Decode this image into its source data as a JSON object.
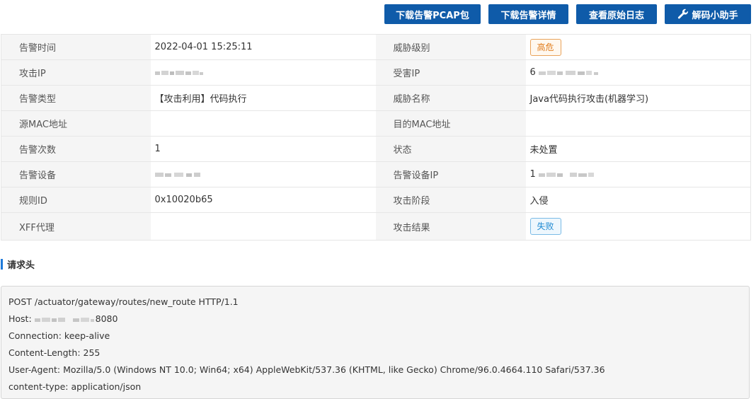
{
  "toolbar": {
    "download_pcap": "下载告警PCAP包",
    "download_detail": "下载告警详情",
    "view_raw_log": "查看原始日志",
    "decode_helper": "解码小助手"
  },
  "info": {
    "alert_time_label": "告警时间",
    "alert_time_value": "2022-04-01 15:25:11",
    "threat_level_label": "威胁级别",
    "threat_level_value": "高危",
    "attack_ip_label": "攻击IP",
    "victim_ip_label": "受害IP",
    "victim_ip_prefix": "6",
    "alert_type_label": "告警类型",
    "alert_type_value": "【攻击利用】代码执行",
    "threat_name_label": "威胁名称",
    "threat_name_value": "Java代码执行攻击(机器学习)",
    "src_mac_label": "源MAC地址",
    "src_mac_value": "",
    "dst_mac_label": "目的MAC地址",
    "dst_mac_value": "",
    "alert_count_label": "告警次数",
    "alert_count_value": "1",
    "status_label": "状态",
    "status_value": "未处置",
    "alert_device_label": "告警设备",
    "alert_device_ip_label": "告警设备IP",
    "alert_device_ip_prefix": "1",
    "rule_id_label": "规则ID",
    "rule_id_value": "0x10020b65",
    "attack_stage_label": "攻击阶段",
    "attack_stage_value": "入侵",
    "xff_label": "XFF代理",
    "xff_value": "",
    "attack_result_label": "攻击结果",
    "attack_result_value": "失败"
  },
  "request_header": {
    "title": "请求头",
    "line1": "POST /actuator/gateway/routes/new_route HTTP/1.1",
    "host_prefix": "Host: ",
    "host_suffix": "8080",
    "line3": "Connection: keep-alive",
    "line4": "Content-Length: 255",
    "line5": "User-Agent: Mozilla/5.0 (Windows NT 10.0; Win64; x64) AppleWebKit/537.36 (KHTML, like Gecko) Chrome/96.0.4664.110 Safari/537.36",
    "line6": "content-type: application/json"
  },
  "colors": {
    "button_bg": "#0f5ba9",
    "high_badge": "#e07b1a",
    "fail_badge": "#1f8ad2",
    "section_accent": "#1f7ad9"
  },
  "icons": {
    "decode_helper": "wrench-icon"
  }
}
